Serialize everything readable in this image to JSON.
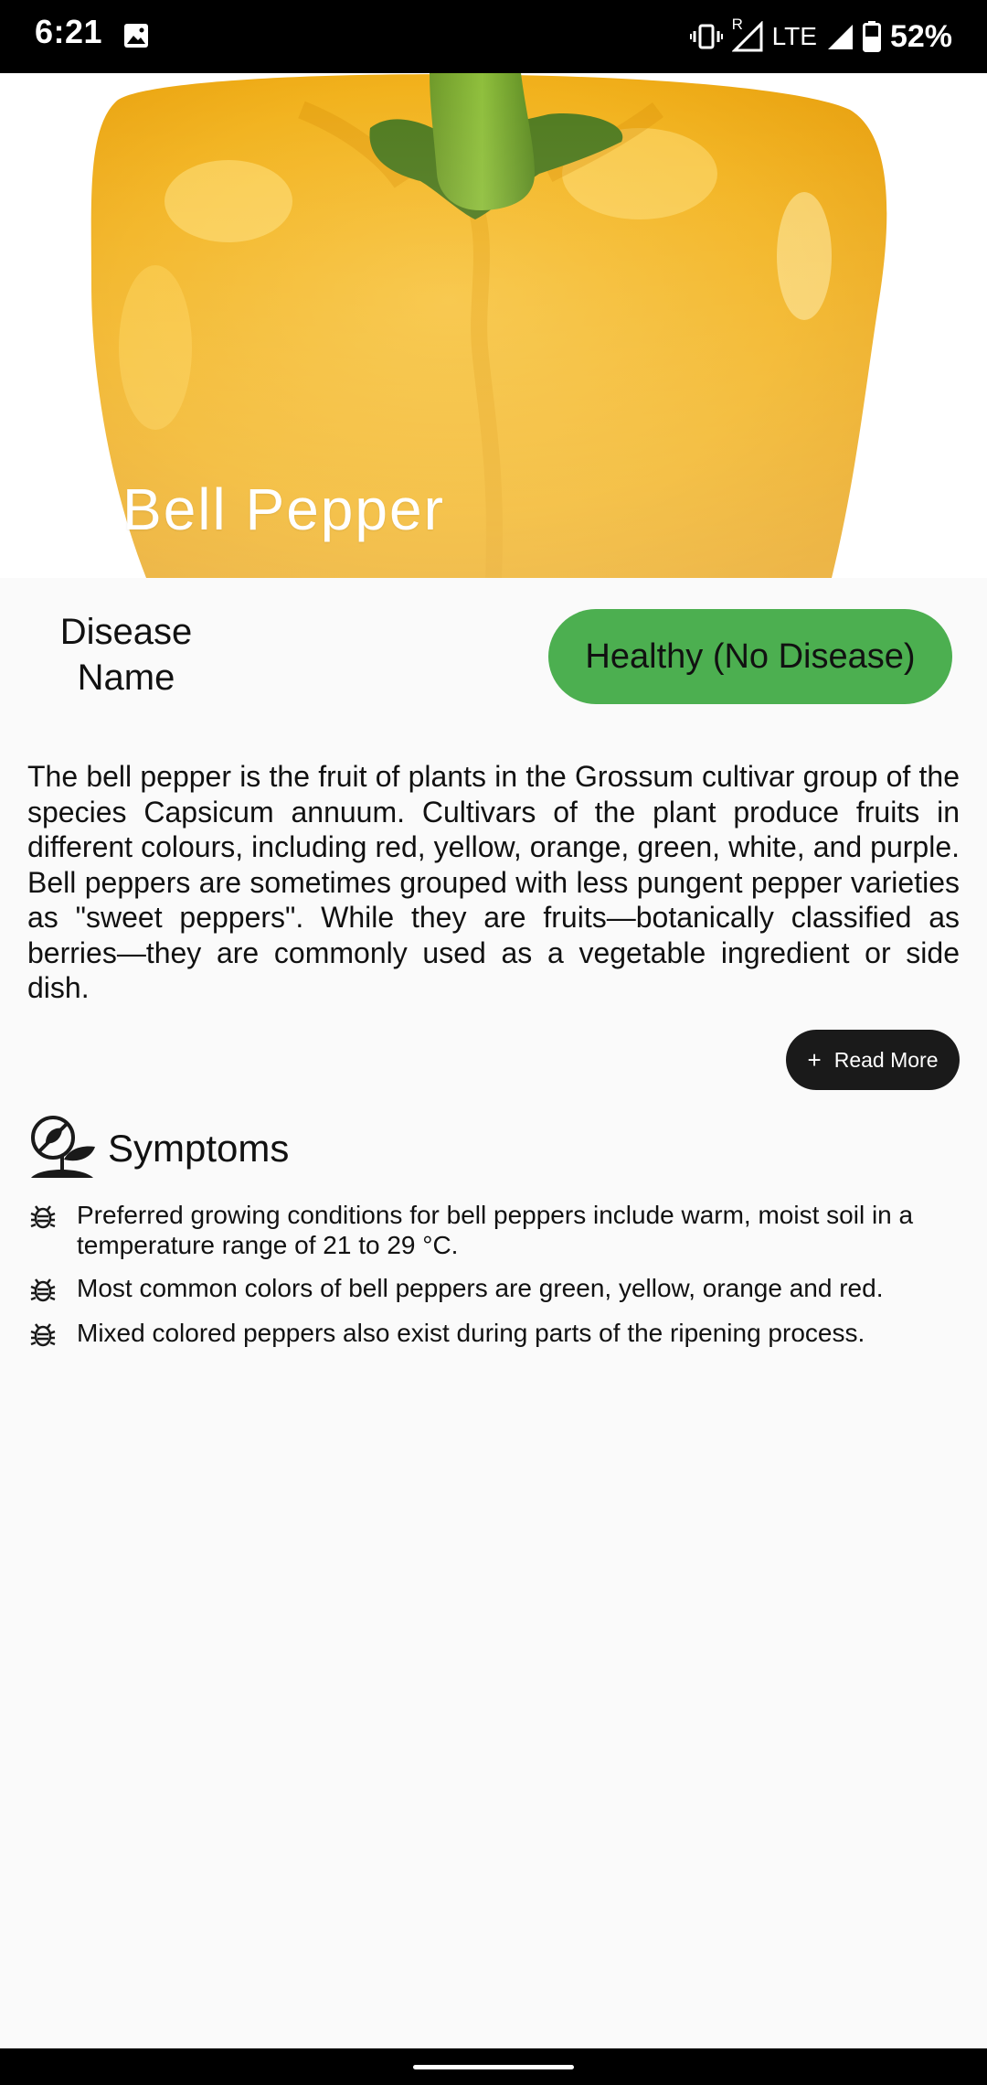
{
  "status_bar": {
    "time": "6:21",
    "network_label": "LTE",
    "roaming_label": "R",
    "battery_percent": "52%"
  },
  "hero": {
    "title": "Bell Pepper",
    "image_subject": "yellow bell pepper"
  },
  "disease": {
    "label_line1": "Disease",
    "label_line2": "Name",
    "status": "Healthy (No Disease)",
    "status_color": "#4caf50"
  },
  "description": "The bell pepper is the fruit of plants in the Grossum cultivar group of the species Capsicum annuum. Cultivars of the plant produce fruits in different colours, including red, yellow, orange, green, white, and purple. Bell peppers are sometimes grouped with less pungent pepper varieties as \"sweet peppers\". While they are fruits—botanically classified as berries—they are commonly used as a vegetable ingredient or side dish.",
  "read_more": {
    "icon": "plus-icon",
    "label": "Read More"
  },
  "symptoms": {
    "title": "Symptoms",
    "header_icon": "plant-disease-icon",
    "item_icon": "bug-icon",
    "items": [
      "Preferred growing conditions for bell peppers include warm, moist soil in a temperature range of 21 to 29 °C.",
      "Most common colors of bell peppers are green, yellow, orange and red.",
      "Mixed colored peppers also exist during parts of the ripening process."
    ]
  }
}
